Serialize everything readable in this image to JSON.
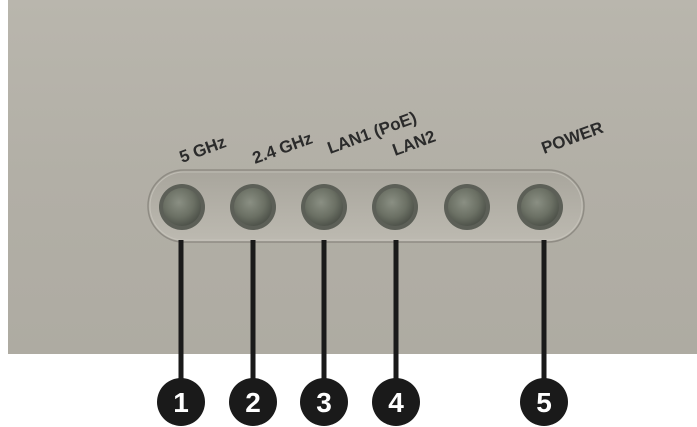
{
  "led_labels": [
    {
      "key": "5ghz",
      "text": "5 GHz"
    },
    {
      "key": "24ghz",
      "text": "2.4 GHz"
    },
    {
      "key": "lan1",
      "text": "LAN1 (PoE)"
    },
    {
      "key": "lan2",
      "text": "LAN2"
    },
    {
      "key": "power",
      "text": "POWER"
    }
  ],
  "callouts": [
    "1",
    "2",
    "3",
    "4",
    "5"
  ],
  "colors": {
    "panel": "#b4b1a8",
    "led_body": "#6e7367",
    "callout": "#1a1a1a",
    "label_text": "#2b2b2b"
  }
}
